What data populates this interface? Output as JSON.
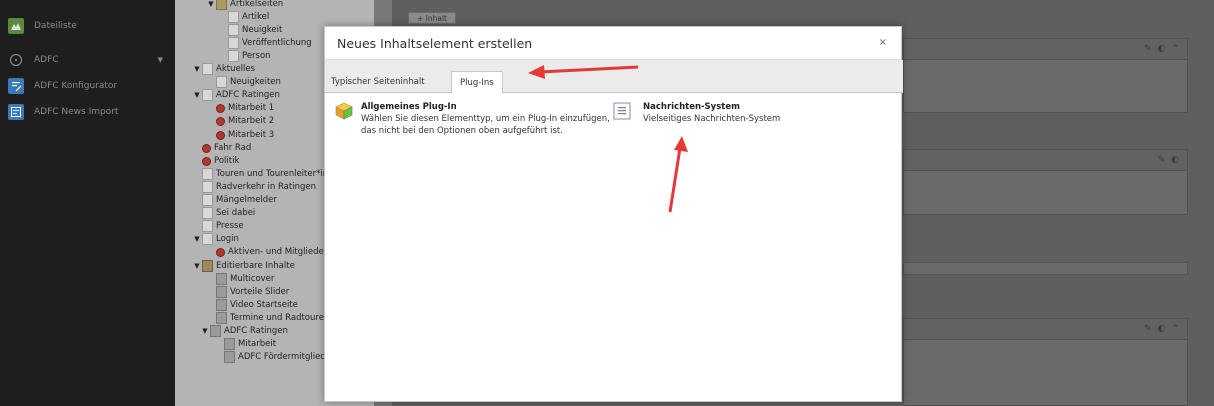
{
  "sidebar": {
    "items": [
      {
        "label": "Dateiliste",
        "icon": "file-list-icon",
        "color": "#5a8a3a"
      },
      {
        "label": "ADFC",
        "icon": "circle-icon",
        "color": "#1e1e1e"
      },
      {
        "label": "ADFC Konfigurator",
        "icon": "configurator-icon",
        "color": "#3a7ab8"
      },
      {
        "label": "ADFC News Import",
        "icon": "news-import-icon",
        "color": "#3a7ab8"
      }
    ]
  },
  "tree": {
    "rows": [
      {
        "label": "Artikelseiten",
        "type": "folder",
        "toggle": "▼"
      },
      {
        "label": "Artikel",
        "type": "page"
      },
      {
        "label": "Neuigkeit",
        "type": "page"
      },
      {
        "label": "Veröffentlichung",
        "type": "page"
      },
      {
        "label": "Person",
        "type": "page"
      },
      {
        "label": "Aktuelles",
        "type": "page",
        "toggle": "▼"
      },
      {
        "label": "Neuigkeiten",
        "type": "page"
      },
      {
        "label": "ADFC Ratingen",
        "type": "page",
        "toggle": "▼"
      },
      {
        "label": "Mitarbeit 1",
        "type": "restricted"
      },
      {
        "label": "Mitarbeit 2",
        "type": "restricted"
      },
      {
        "label": "Mitarbeit 3",
        "type": "restricted"
      },
      {
        "label": "Fahr Rad",
        "type": "restricted"
      },
      {
        "label": "Politik",
        "type": "restricted"
      },
      {
        "label": "Touren und Tourenleiter*in",
        "type": "page"
      },
      {
        "label": "Radverkehr in Ratingen",
        "type": "page"
      },
      {
        "label": "Mängelmelder",
        "type": "page"
      },
      {
        "label": "Sei dabei",
        "type": "page"
      },
      {
        "label": "Presse",
        "type": "page"
      },
      {
        "label": "Login",
        "type": "login",
        "toggle": "▼"
      },
      {
        "label": "Aktiven- und Mitgliedert",
        "type": "restricted"
      },
      {
        "label": "Editierbare Inhalte",
        "type": "editable",
        "toggle": "▼"
      },
      {
        "label": "Multicover",
        "type": "content"
      },
      {
        "label": "Vorteile Slider",
        "type": "content"
      },
      {
        "label": "Video Startseite",
        "type": "content"
      },
      {
        "label": "Termine und Radtouren",
        "type": "content"
      },
      {
        "label": "ADFC Ratingen",
        "type": "content",
        "toggle": "▼"
      },
      {
        "label": "Mitarbeit",
        "type": "content"
      },
      {
        "label": "ADFC Fördermitglieder",
        "type": "content"
      }
    ]
  },
  "content": {
    "add_button": "+ Inhalt"
  },
  "modal": {
    "title": "Neues Inhaltselement erstellen",
    "close": "×",
    "tabs": [
      {
        "label": "Typischer Seiteninhalt",
        "active": false
      },
      {
        "label": "Plug-Ins",
        "active": true
      }
    ],
    "items": [
      {
        "title": "Allgemeines Plug-In",
        "description": "Wählen Sie diesen Elementtyp, um ein Plug-In einzufügen, das nicht bei den Optionen oben aufgeführt ist.",
        "icon": "plugin-cube-icon"
      },
      {
        "title": "Nachrichten-System",
        "description": "Vielseitiges Nachrichten-System",
        "icon": "news-system-icon"
      }
    ]
  },
  "annotation_color": "#e53935"
}
